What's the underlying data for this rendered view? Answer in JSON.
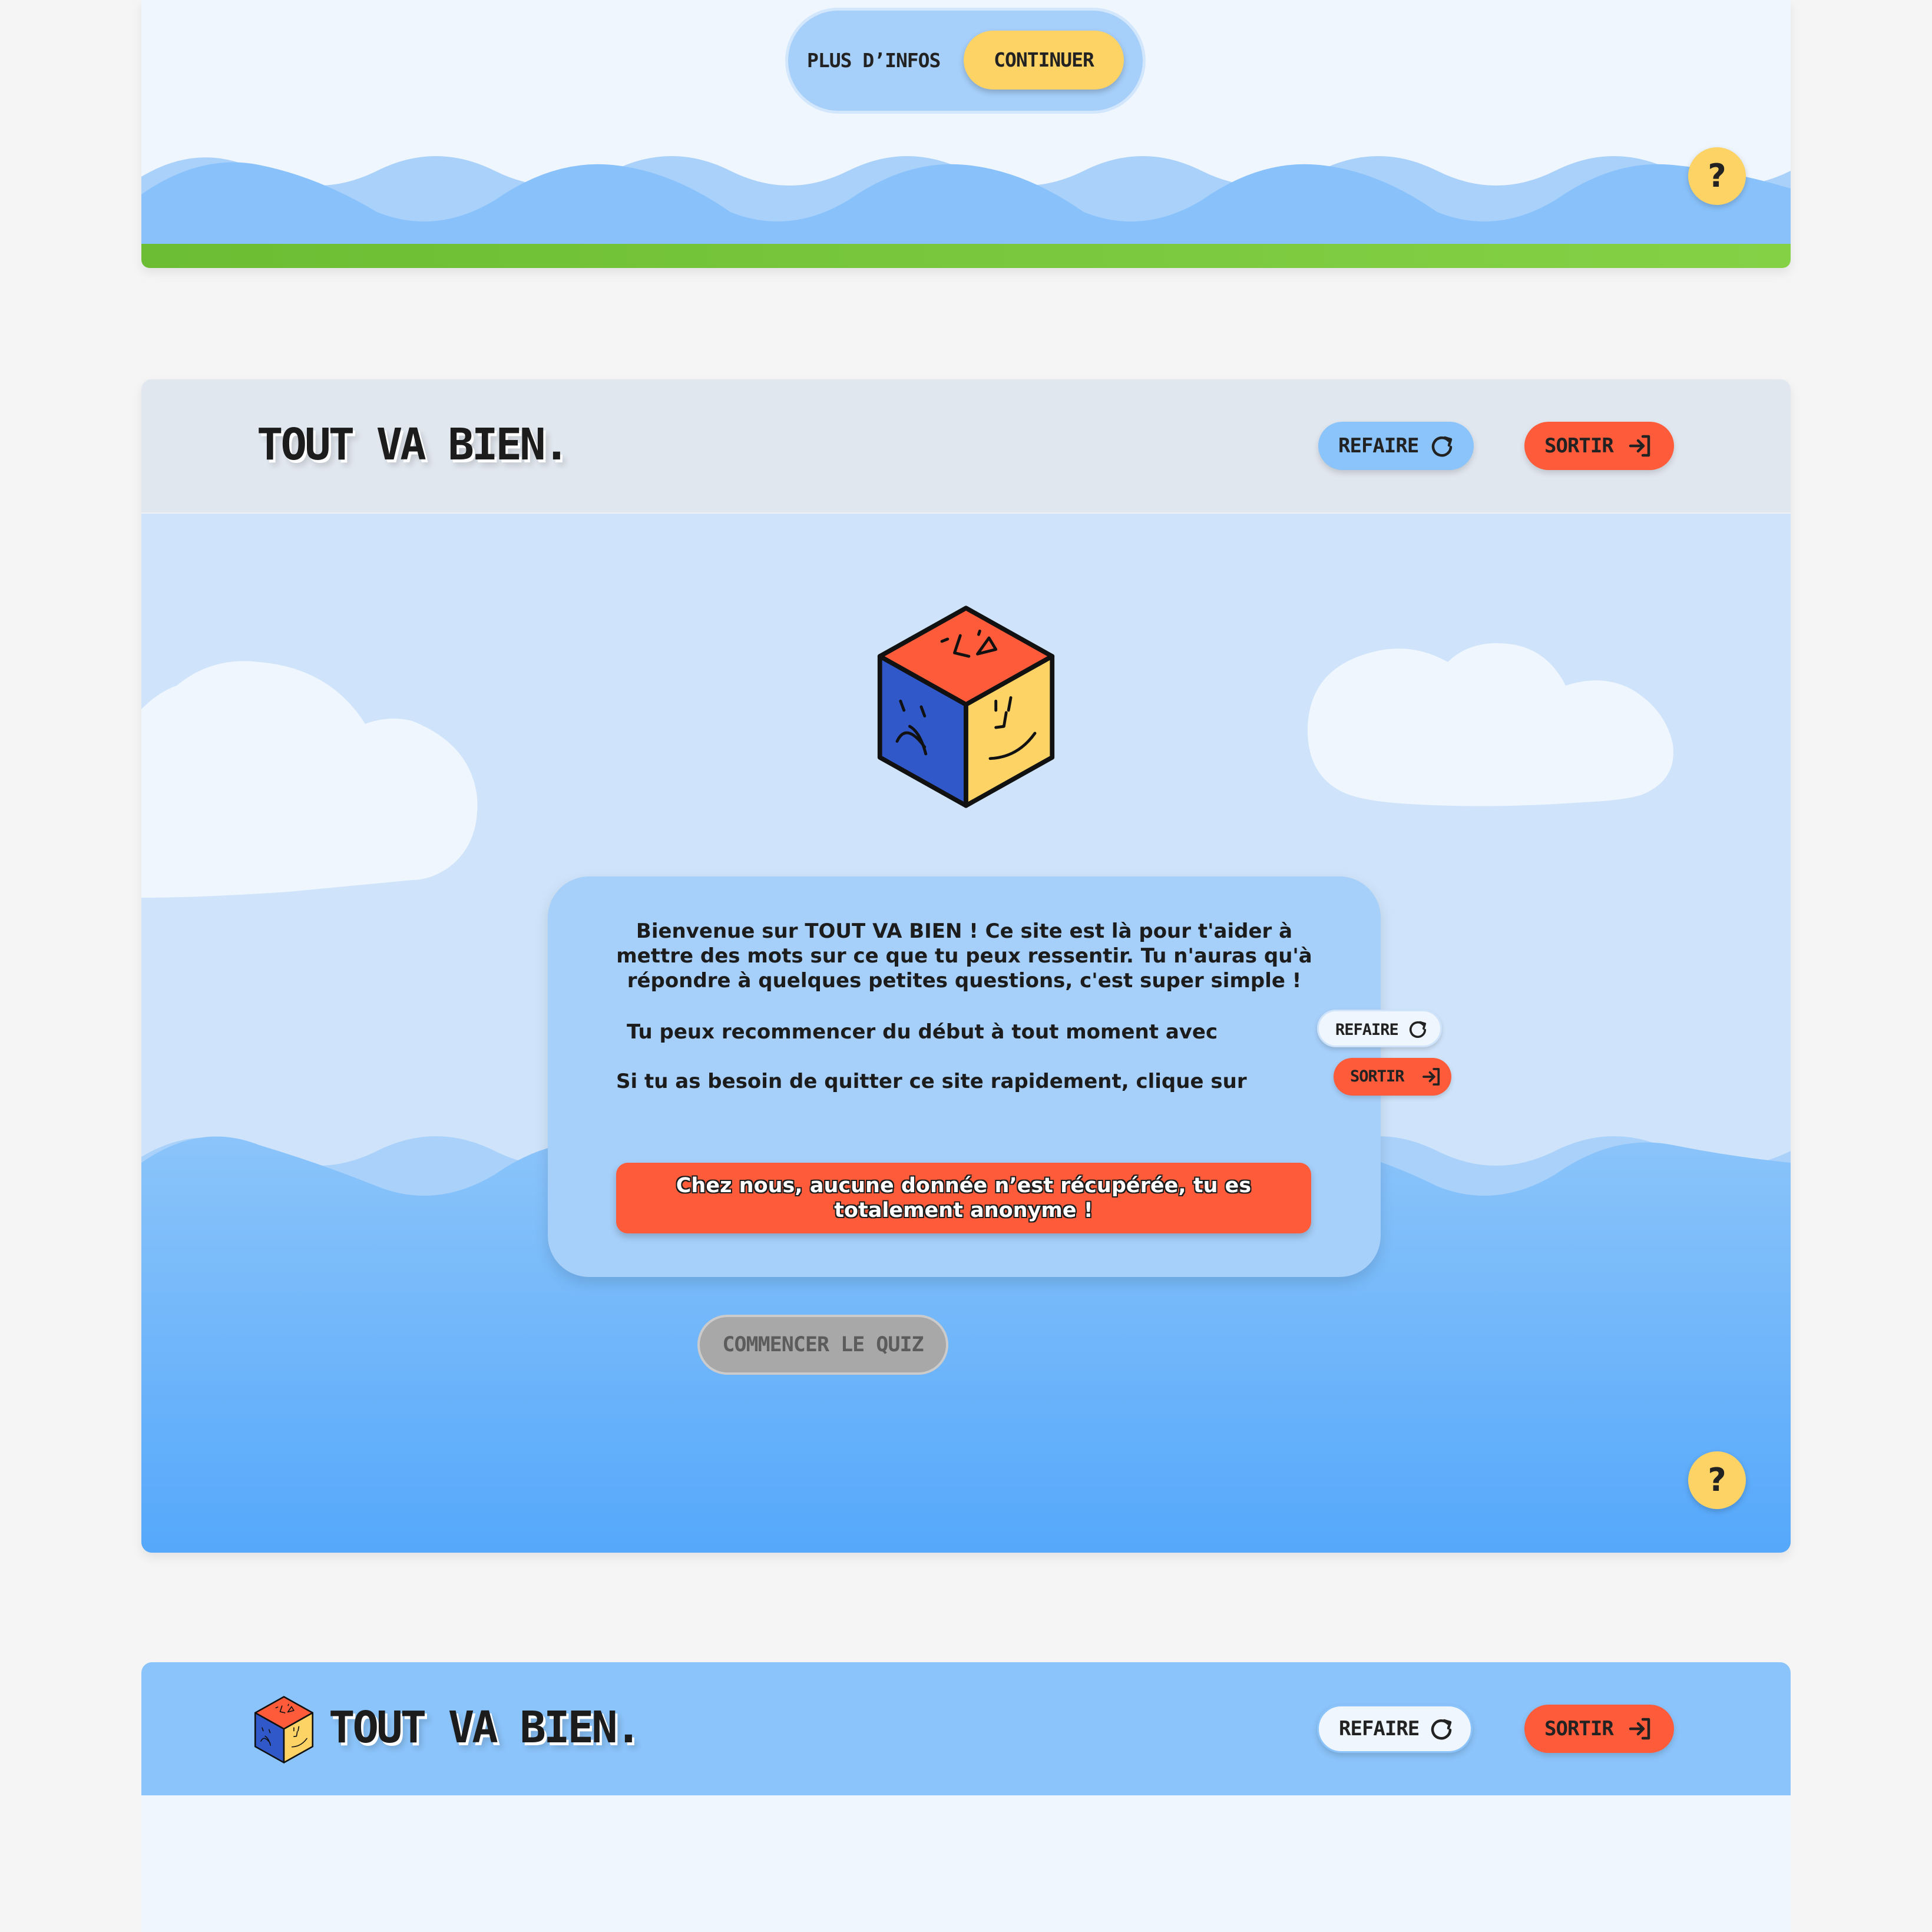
{
  "top_panel": {
    "more_info_label": "PLUS D’INFOS",
    "continue_label": "CONTINUER",
    "help_label": "?"
  },
  "welcome_screen": {
    "logo_text": "TOUT VA BIEN.",
    "refaire_label": "REFAIRE",
    "sortir_label": "SORTIR",
    "intro_text": "Bienvenue sur TOUT VA BIEN ! Ce site est là pour t'aider à mettre des mots sur ce que tu peux ressentir. Tu n'auras qu'à répondre à quelques petites questions, c'est super simple !",
    "restart_hint": "Tu peux recommencer du début à tout moment avec",
    "exit_hint": "Si tu as besoin de quitter ce site rapidement, clique sur",
    "anonymous_notice": "Chez nous, aucune donnée n’est récupérée, tu es totalement anonyme !",
    "start_quiz_label": "COMMENCER LE QUIZ",
    "help_label": "?"
  },
  "bottom_panel": {
    "logo_text": "TOUT VA BIEN.",
    "refaire_label": "REFAIRE",
    "sortir_label": "SORTIR"
  },
  "colors": {
    "sky_light": "#eff6fe",
    "sky_blue": "#a6cff9",
    "water_blue": "#8bc4fa",
    "accent_yellow": "#fdd366",
    "accent_red": "#fd5b3a",
    "progress_green": "#78c83c",
    "cube_red": "#fd5b3a",
    "cube_blue": "#3058c8",
    "cube_yellow": "#fdd366"
  },
  "icons": [
    "refresh-icon",
    "exit-icon",
    "cube-logo-icon",
    "cloud-shape",
    "wave-shape"
  ]
}
